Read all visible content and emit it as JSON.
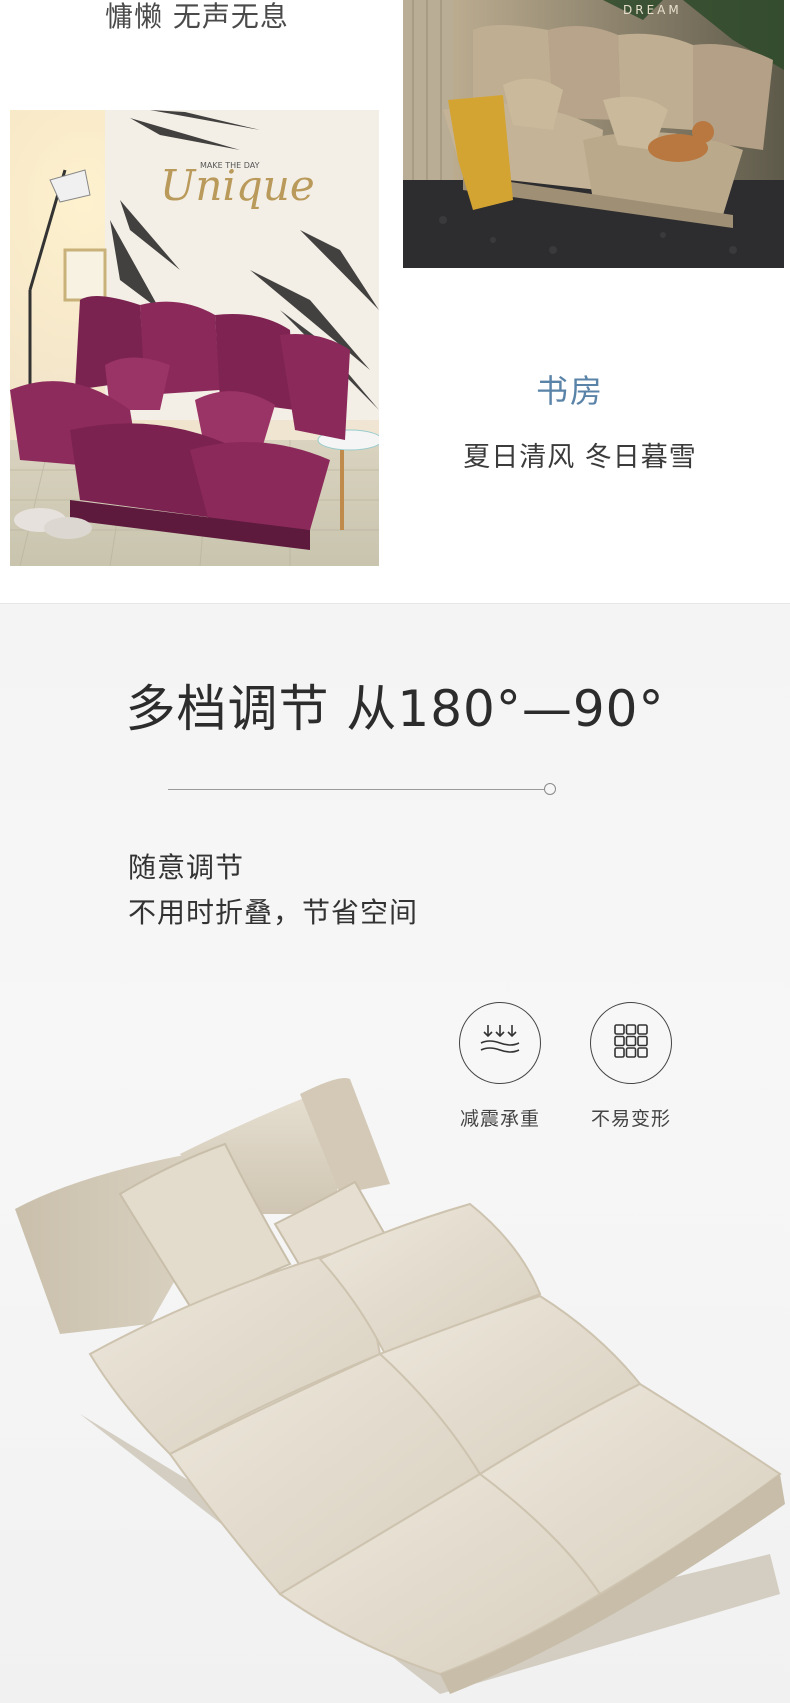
{
  "top": {
    "caption": "慵懒 无声无息",
    "photo_purple_print_title": "Unique",
    "photo_purple_print_sub": "MAKE THE DAY",
    "photo_beige_print": "DREAM",
    "room_title": "书房",
    "room_subtitle": "夏日清风 冬日暮雪"
  },
  "feature": {
    "headline": "多档调节 从180°—90°",
    "line1": "随意调节",
    "line2": "不用时折叠，节省空间",
    "badges": [
      {
        "icon": "shock-absorb-icon",
        "label": "减震承重"
      },
      {
        "icon": "grid-icon",
        "label": "不易变形"
      }
    ]
  },
  "colors": {
    "accent_blue": "#5a83a8",
    "sofa_purple": "#8b2a5a",
    "sofa_beige_dark": "#b8a48a",
    "sofa_cream": "#e4dccd"
  }
}
